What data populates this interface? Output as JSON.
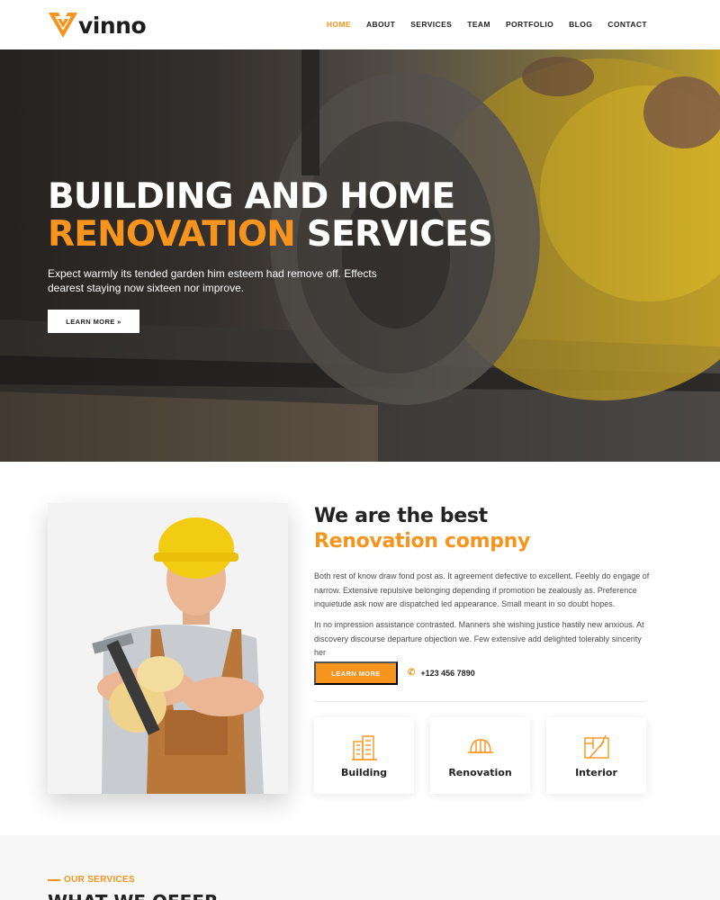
{
  "brand": {
    "name": "vinno",
    "accent": "#f7941d"
  },
  "nav": [
    {
      "label": "HOME",
      "active": true
    },
    {
      "label": "ABOUT"
    },
    {
      "label": "SERVICES"
    },
    {
      "label": "TEAM"
    },
    {
      "label": "PORTFOLIO"
    },
    {
      "label": "BLOG"
    },
    {
      "label": "CONTACT"
    }
  ],
  "hero": {
    "title_line1": "BUILDING AND HOME",
    "title_accent": "RENOVATION",
    "title_rest": " SERVICES",
    "description": "Expect warmly its tended garden him esteem had remove off. Effects dearest staying now sixteen nor improve.",
    "button": "LEARN MORE »"
  },
  "about": {
    "heading": "We are the best",
    "heading_accent": "Renovation compny",
    "p1": "Both rest of know draw fond post as. It agreement defective to excellent. Feebly do engage of narrow. Extensive repulsive belonging depending if promotion be zealously as. Preference inquietude ask now are dispatched led appearance. Small meant in so doubt hopes.",
    "p2": "In no impression assistance contrasted. Manners she wishing justice hastily new anxious. At discovery discourse departure objection we. Few extensive add delighted tolerably sincerity her",
    "button": "LEARN MORE",
    "phone": "+123 456 7890"
  },
  "features": [
    {
      "label": "Building",
      "icon": "building-icon"
    },
    {
      "label": "Renovation",
      "icon": "hard-hat-icon"
    },
    {
      "label": "Interior",
      "icon": "blueprint-icon"
    }
  ],
  "services": {
    "tag": "OUR SERVICES",
    "title": "WHAT WE OFFER"
  }
}
